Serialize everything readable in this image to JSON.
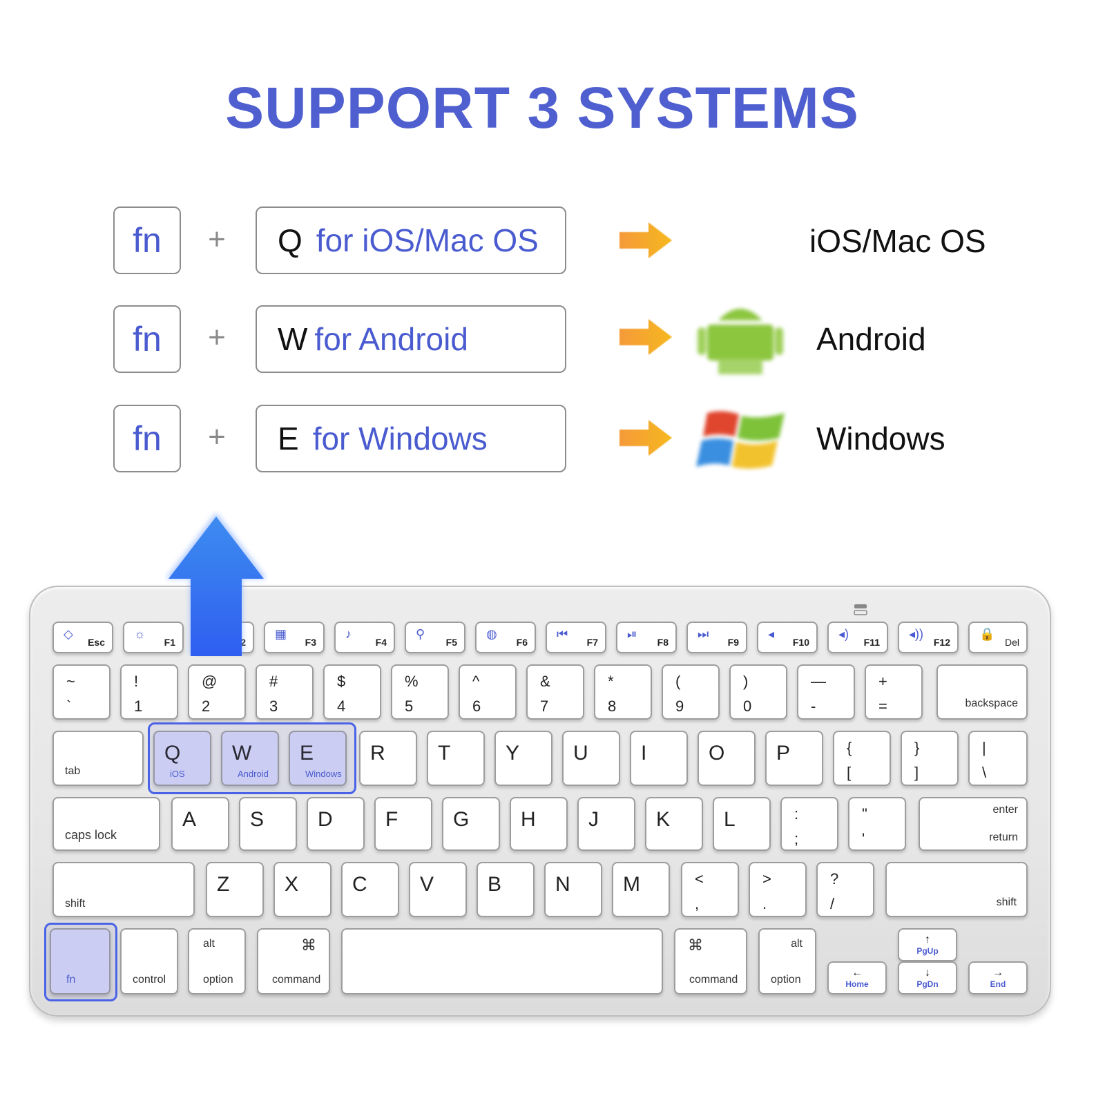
{
  "title": "SUPPORT 3 SYSTEMS",
  "colors": {
    "accent_blue": "#4f5fcf",
    "highlight_frame": "#4a63e6",
    "arrow_orange": "#f5a623",
    "android_green": "#8bc34a"
  },
  "combos": [
    {
      "modifier": "fn",
      "plus": "+",
      "key": "Q",
      "desc": "for iOS/Mac OS",
      "arrow_icon": "arrow-right-icon",
      "os_icon": "apple-icon",
      "os_name": "iOS/Mac OS"
    },
    {
      "modifier": "fn",
      "plus": "+",
      "key": "W",
      "desc": "for Android",
      "arrow_icon": "arrow-right-icon",
      "os_icon": "android-icon",
      "os_name": "Android"
    },
    {
      "modifier": "fn",
      "plus": "+",
      "key": "E",
      "desc": "for Windows",
      "arrow_icon": "arrow-right-icon",
      "os_icon": "windows-icon",
      "os_name": "Windows"
    }
  ],
  "keyboard": {
    "frow": [
      {
        "fn": "F1",
        "icon": "brightness-icon"
      },
      {
        "fn": "F2",
        "icon": ""
      },
      {
        "fn": "F3",
        "icon": "keyboard-icon"
      },
      {
        "fn": "F4",
        "icon": "music-icon"
      },
      {
        "fn": "F5",
        "icon": "search-icon"
      },
      {
        "fn": "F6",
        "icon": "globe-icon"
      },
      {
        "fn": "F7",
        "icon": "previous-track-icon"
      },
      {
        "fn": "F8",
        "icon": "play-pause-icon"
      },
      {
        "fn": "F9",
        "icon": "next-track-icon"
      },
      {
        "fn": "F10",
        "icon": "mute-icon"
      },
      {
        "fn": "F11",
        "icon": "volume-down-icon"
      },
      {
        "fn": "F12",
        "icon": "volume-up-icon"
      }
    ],
    "esc": "Esc",
    "del": "Del",
    "glyphs": {
      "F1": "☼",
      "F3": "▦",
      "F4": "♪",
      "F5": "⚲",
      "F6": "◍",
      "F7": "⏮",
      "F8": "⏯",
      "F9": "⏭",
      "F10": "◂",
      "F11": "◂)",
      "F12": "◂))",
      "Esc": "◇",
      "Del": "🔒"
    },
    "numrow": [
      {
        "top": "~",
        "bottom": "`"
      },
      {
        "top": "!",
        "bottom": "1"
      },
      {
        "top": "@",
        "bottom": "2"
      },
      {
        "top": "#",
        "bottom": "3"
      },
      {
        "top": "$",
        "bottom": "4"
      },
      {
        "top": "%",
        "bottom": "5"
      },
      {
        "top": "^",
        "bottom": "6"
      },
      {
        "top": "&",
        "bottom": "7"
      },
      {
        "top": "*",
        "bottom": "8"
      },
      {
        "top": "(",
        "bottom": "9"
      },
      {
        "top": ")",
        "bottom": "0"
      },
      {
        "top": "—",
        "bottom": "-"
      },
      {
        "top": "+",
        "bottom": "="
      }
    ],
    "backspace": "backspace",
    "tab": "tab",
    "qwe": [
      {
        "key": "Q",
        "os": "iOS"
      },
      {
        "key": "W",
        "os": "Android"
      },
      {
        "key": "E",
        "os": "Windows"
      }
    ],
    "toprow": [
      "R",
      "T",
      "Y",
      "U",
      "I",
      "O",
      "P"
    ],
    "brackets": [
      {
        "top": "{",
        "bottom": "["
      },
      {
        "top": "}",
        "bottom": "]"
      },
      {
        "top": "|",
        "bottom": "\\"
      }
    ],
    "caps": "caps lock",
    "homerow": [
      "A",
      "S",
      "D",
      "F",
      "G",
      "H",
      "J",
      "K",
      "L"
    ],
    "semi": [
      {
        "top": ":",
        "bottom": ";"
      },
      {
        "top": "\"",
        "bottom": "'"
      }
    ],
    "enter_top": "enter",
    "enter_bottom": "return",
    "shift": "shift",
    "bottomrow": [
      "Z",
      "X",
      "C",
      "V",
      "B",
      "N",
      "M"
    ],
    "punct": [
      {
        "top": "<",
        "bottom": ","
      },
      {
        "top": ">",
        "bottom": "."
      },
      {
        "top": "?",
        "bottom": "/"
      }
    ],
    "fn": "fn",
    "control": "control",
    "alt": "alt",
    "option": "option",
    "command_symbol": "⌘",
    "command": "command",
    "home": {
      "sym": "←",
      "label": "Home"
    },
    "pgup": {
      "sym": "↑",
      "label": "PgUp"
    },
    "pgdn": {
      "sym": "↓",
      "label": "PgDn"
    },
    "end": {
      "sym": "→",
      "label": "End"
    }
  }
}
